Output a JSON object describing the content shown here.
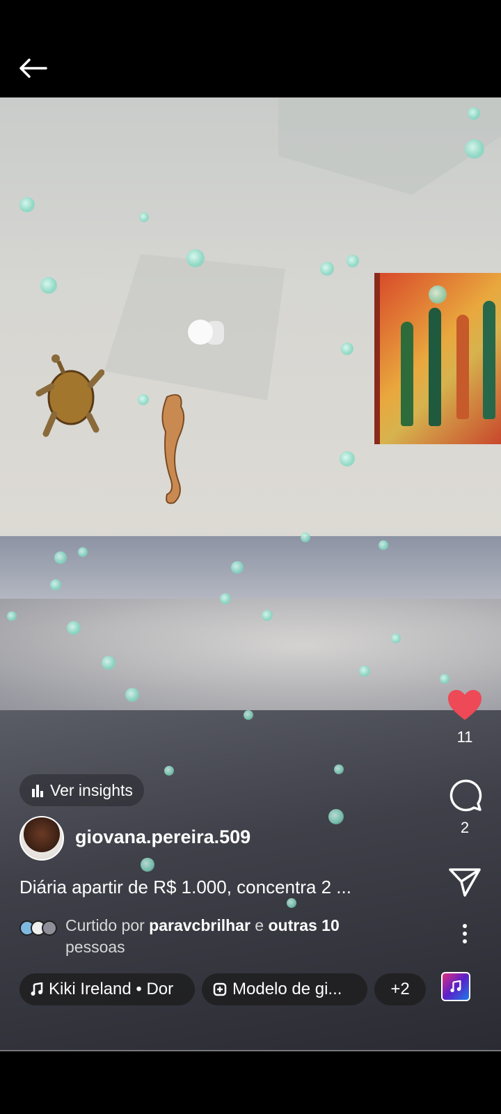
{
  "header": {
    "back_icon": "arrow-left-icon"
  },
  "post": {
    "like_count": "11",
    "comment_count": "2",
    "liked": true,
    "like_color": "#ed4956"
  },
  "insights": {
    "label": "Ver insights",
    "icon": "bar-chart-icon"
  },
  "author": {
    "username": "giovana.pereira.509"
  },
  "caption": {
    "text": "Diária apartir de R$ 1.000, concentra 2 ..."
  },
  "likes": {
    "prefix": "Curtido por ",
    "user": "paravcbrilhar",
    "middle": " e ",
    "others": "outras 10",
    "suffix": "pessoas"
  },
  "chips": {
    "music": "Kiki Ireland • Dor",
    "template": "Modelo de gi...",
    "more": "+2"
  }
}
